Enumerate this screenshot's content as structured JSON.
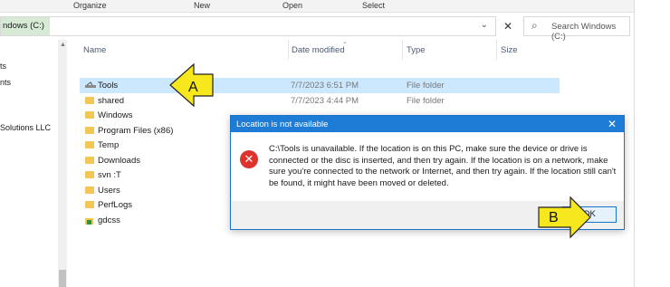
{
  "ribbon": {
    "items": [
      "Organize",
      "New",
      "Open",
      "Select"
    ]
  },
  "address": {
    "segment": "ndows (C:)",
    "chevron": "⌄"
  },
  "address_close": "✕",
  "search": {
    "placeholder": "Search Windows (C:)",
    "icon": "search-icon"
  },
  "nav": {
    "items": [
      "ts",
      "nts",
      "Solutions LLC"
    ]
  },
  "columns": {
    "name": "Name",
    "date": "Date modified",
    "type": "Type",
    "size": "Size"
  },
  "files": [
    {
      "name": "Tools",
      "date": "7/7/2023 6:51 PM",
      "type": "File folder",
      "selected": true,
      "icon": "broken-drive-icon"
    },
    {
      "name": "shared",
      "date": "7/7/2023 4:44 PM",
      "type": "File folder",
      "icon": "folder-icon"
    },
    {
      "name": "Windows",
      "date": "",
      "type": "",
      "icon": "folder-icon"
    },
    {
      "name": "Program Files (x86)",
      "date": "",
      "type": "",
      "icon": "folder-icon"
    },
    {
      "name": "Temp",
      "date": "",
      "type": "",
      "icon": "folder-icon"
    },
    {
      "name": "Downloads",
      "date": "",
      "type": "",
      "icon": "folder-icon"
    },
    {
      "name": "svn                    :T",
      "date": "",
      "type": "",
      "icon": "folder-icon"
    },
    {
      "name": "Users",
      "date": "",
      "type": "",
      "icon": "folder-icon"
    },
    {
      "name": "PerfLogs",
      "date": "",
      "type": "",
      "icon": "folder-icon"
    },
    {
      "name": "gdcss",
      "date": "",
      "type": "",
      "icon": "app-folder-icon"
    }
  ],
  "dialog": {
    "title": "Location is not available",
    "close": "✕",
    "error_icon": "✕",
    "message": "C:\\Tools is unavailable. If the location is on this PC, make sure the device or drive is connected or the disc is inserted, and then try again. If the location is on a network, make sure you're connected to the network or Internet, and then try again. If the location still can't be found, it might have been moved or deleted.",
    "ok_label": "OK"
  },
  "callouts": {
    "a_label": "A",
    "b_label": "B",
    "color": "#f7e81e"
  }
}
